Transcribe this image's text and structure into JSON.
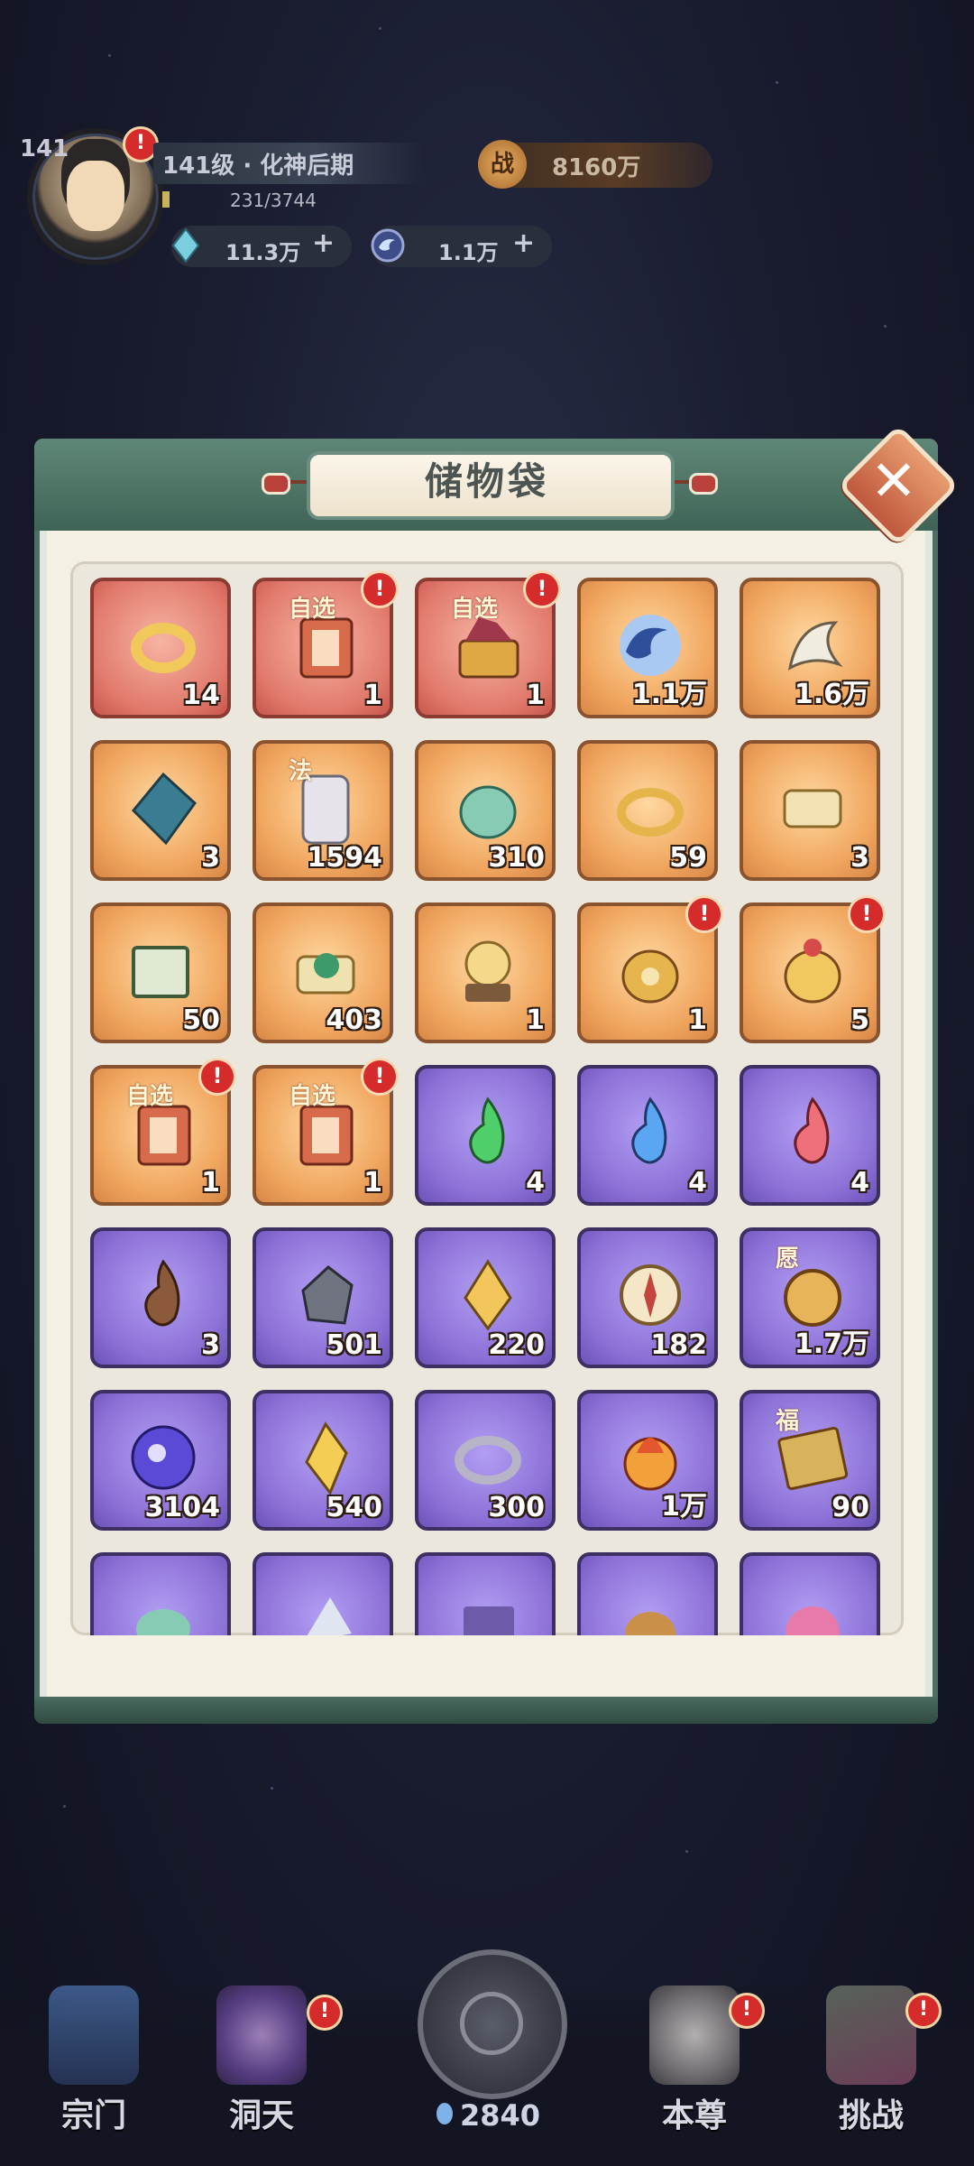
{
  "player": {
    "level_badge": "141",
    "level_text": "141级 · 化神后期",
    "exp_text": "231/3744",
    "power_icon": "战",
    "power_value": "8160万",
    "crystal_value": "11.3万",
    "coin_value": "1.1万",
    "plus": "+"
  },
  "panel": {
    "title": "储物袋",
    "close": "✕"
  },
  "items": [
    {
      "bg": "red",
      "count": "14",
      "icon": "gold-ring",
      "badge": false,
      "tag": ""
    },
    {
      "bg": "red",
      "count": "1",
      "icon": "select-book",
      "badge": true,
      "tag": "自选"
    },
    {
      "bg": "red",
      "count": "1",
      "icon": "select-chest",
      "badge": true,
      "tag": "自选"
    },
    {
      "bg": "gold",
      "count": "1.1万",
      "icon": "blue-swirl",
      "badge": false,
      "tag": ""
    },
    {
      "bg": "gold",
      "count": "1.6万",
      "icon": "white-claw",
      "badge": false,
      "tag": ""
    },
    {
      "bg": "gold",
      "count": "3",
      "icon": "blue-shard",
      "badge": false,
      "tag": ""
    },
    {
      "bg": "gold",
      "count": "1594",
      "icon": "law-token",
      "badge": false,
      "tag": "法"
    },
    {
      "bg": "gold",
      "count": "310",
      "icon": "jade-beast",
      "badge": false,
      "tag": ""
    },
    {
      "bg": "gold",
      "count": "59",
      "icon": "gold-bangle",
      "badge": false,
      "tag": ""
    },
    {
      "bg": "gold",
      "count": "3",
      "icon": "scroll",
      "badge": false,
      "tag": ""
    },
    {
      "bg": "gold",
      "count": "50",
      "icon": "green-books",
      "badge": false,
      "tag": ""
    },
    {
      "bg": "gold",
      "count": "403",
      "icon": "herb-scroll",
      "badge": false,
      "tag": ""
    },
    {
      "bg": "gold",
      "count": "1",
      "icon": "crystal-ball",
      "badge": false,
      "tag": ""
    },
    {
      "bg": "gold",
      "count": "1",
      "icon": "mystery-bag",
      "badge": true,
      "tag": ""
    },
    {
      "bg": "gold",
      "count": "5",
      "icon": "treasure-bag",
      "badge": true,
      "tag": ""
    },
    {
      "bg": "gold",
      "count": "1",
      "icon": "select-book",
      "badge": true,
      "tag": "自选"
    },
    {
      "bg": "gold",
      "count": "1",
      "icon": "select-book",
      "badge": true,
      "tag": "自选"
    },
    {
      "bg": "purple",
      "count": "4",
      "icon": "green-flame",
      "badge": false,
      "tag": ""
    },
    {
      "bg": "purple",
      "count": "4",
      "icon": "blue-flame",
      "badge": false,
      "tag": ""
    },
    {
      "bg": "purple",
      "count": "4",
      "icon": "red-flame",
      "badge": false,
      "tag": ""
    },
    {
      "bg": "purple",
      "count": "3",
      "icon": "dark-flame",
      "badge": false,
      "tag": ""
    },
    {
      "bg": "purple",
      "count": "501",
      "icon": "iron-ore",
      "badge": false,
      "tag": ""
    },
    {
      "bg": "purple",
      "count": "220",
      "icon": "gold-crystal",
      "badge": false,
      "tag": ""
    },
    {
      "bg": "purple",
      "count": "182",
      "icon": "compass",
      "badge": false,
      "tag": ""
    },
    {
      "bg": "purple",
      "count": "1.7万",
      "icon": "wish-coin",
      "badge": false,
      "tag": "愿"
    },
    {
      "bg": "purple",
      "count": "3104",
      "icon": "purple-orb",
      "badge": false,
      "tag": ""
    },
    {
      "bg": "purple",
      "count": "540",
      "icon": "gold-gem",
      "badge": false,
      "tag": ""
    },
    {
      "bg": "purple",
      "count": "300",
      "icon": "silver-ring",
      "badge": false,
      "tag": ""
    },
    {
      "bg": "purple",
      "count": "1万",
      "icon": "fire-orb",
      "badge": false,
      "tag": ""
    },
    {
      "bg": "purple",
      "count": "90",
      "icon": "fortune-ticket",
      "badge": false,
      "tag": "福"
    },
    {
      "bg": "purple",
      "count": "",
      "icon": "jade-item",
      "badge": false,
      "tag": ""
    },
    {
      "bg": "purple",
      "count": "",
      "icon": "paper-item",
      "badge": false,
      "tag": ""
    },
    {
      "bg": "purple",
      "count": "",
      "icon": "book-item",
      "badge": false,
      "tag": ""
    },
    {
      "bg": "purple",
      "count": "",
      "icon": "pouch-item",
      "badge": false,
      "tag": ""
    },
    {
      "bg": "purple",
      "count": "",
      "icon": "pink-orb",
      "badge": false,
      "tag": ""
    }
  ],
  "nav": {
    "items": [
      {
        "label": "宗门",
        "icon": "sect-icon",
        "badge": false
      },
      {
        "label": "洞天",
        "icon": "cave-icon",
        "badge": true
      },
      {
        "label": "本尊",
        "icon": "self-icon",
        "badge": true
      },
      {
        "label": "挑战",
        "icon": "challenge-icon",
        "badge": true
      }
    ],
    "spirit_value": "2840"
  },
  "colors": {
    "red_bg": "#e17a6c",
    "gold_bg": "#f0a65f",
    "purple_bg": "#8d72d8",
    "badge_red": "#d62b2b"
  }
}
